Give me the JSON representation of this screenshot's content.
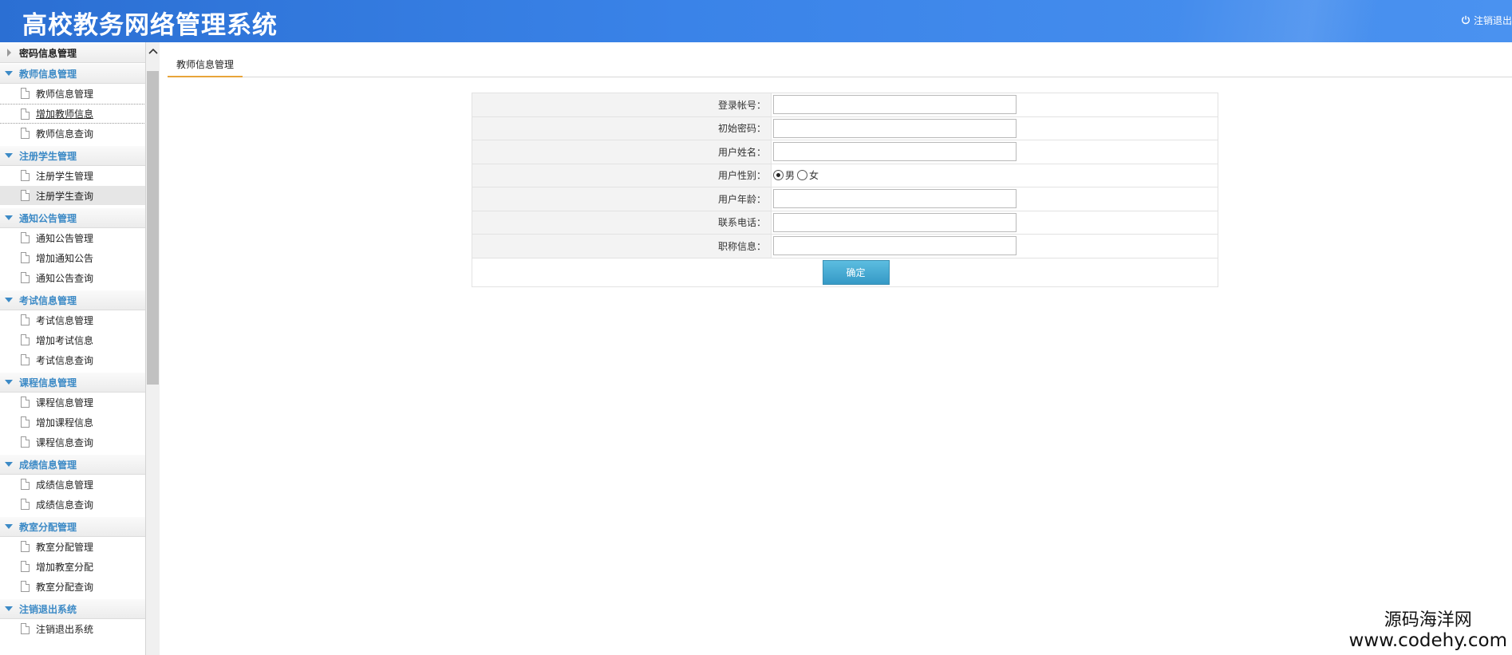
{
  "header": {
    "title": "高校教务网络管理系统",
    "logout_label": "注销退出"
  },
  "sidebar": {
    "groups": [
      {
        "title": "密码信息管理",
        "collapsed": true,
        "items": []
      },
      {
        "title": "教师信息管理",
        "collapsed": false,
        "items": [
          "教师信息管理",
          "增加教师信息",
          "教师信息查询"
        ]
      },
      {
        "title": "注册学生管理",
        "collapsed": false,
        "items": [
          "注册学生管理",
          "注册学生查询"
        ]
      },
      {
        "title": "通知公告管理",
        "collapsed": false,
        "items": [
          "通知公告管理",
          "增加通知公告",
          "通知公告查询"
        ]
      },
      {
        "title": "考试信息管理",
        "collapsed": false,
        "items": [
          "考试信息管理",
          "增加考试信息",
          "考试信息查询"
        ]
      },
      {
        "title": "课程信息管理",
        "collapsed": false,
        "items": [
          "课程信息管理",
          "增加课程信息",
          "课程信息查询"
        ]
      },
      {
        "title": "成绩信息管理",
        "collapsed": false,
        "items": [
          "成绩信息管理",
          "成绩信息查询"
        ]
      },
      {
        "title": "教室分配管理",
        "collapsed": false,
        "items": [
          "教室分配管理",
          "增加教室分配",
          "教室分配查询"
        ]
      },
      {
        "title": "注销退出系统",
        "collapsed": false,
        "items": [
          "注销退出系统"
        ]
      }
    ],
    "active_item": "增加教师信息",
    "hover_item": "注册学生查询"
  },
  "tab": {
    "label": "教师信息管理"
  },
  "form": {
    "fields": [
      {
        "label": "登录帐号：",
        "value": ""
      },
      {
        "label": "初始密码：",
        "value": ""
      },
      {
        "label": "用户姓名：",
        "value": ""
      },
      {
        "label": "用户性别：",
        "type": "radio",
        "options": [
          "男",
          "女"
        ],
        "selected": "男"
      },
      {
        "label": "用户年龄：",
        "value": ""
      },
      {
        "label": "联系电话：",
        "value": ""
      },
      {
        "label": "职称信息：",
        "value": ""
      }
    ],
    "submit_label": "确定"
  },
  "watermark": {
    "line1": "源码海洋网",
    "line2": "www.codehy.com"
  },
  "colors": {
    "header_blue": "#3a83e8",
    "accent_blue": "#3c8ac6",
    "tab_underline": "#e8a53a",
    "button": "#3599c6"
  }
}
